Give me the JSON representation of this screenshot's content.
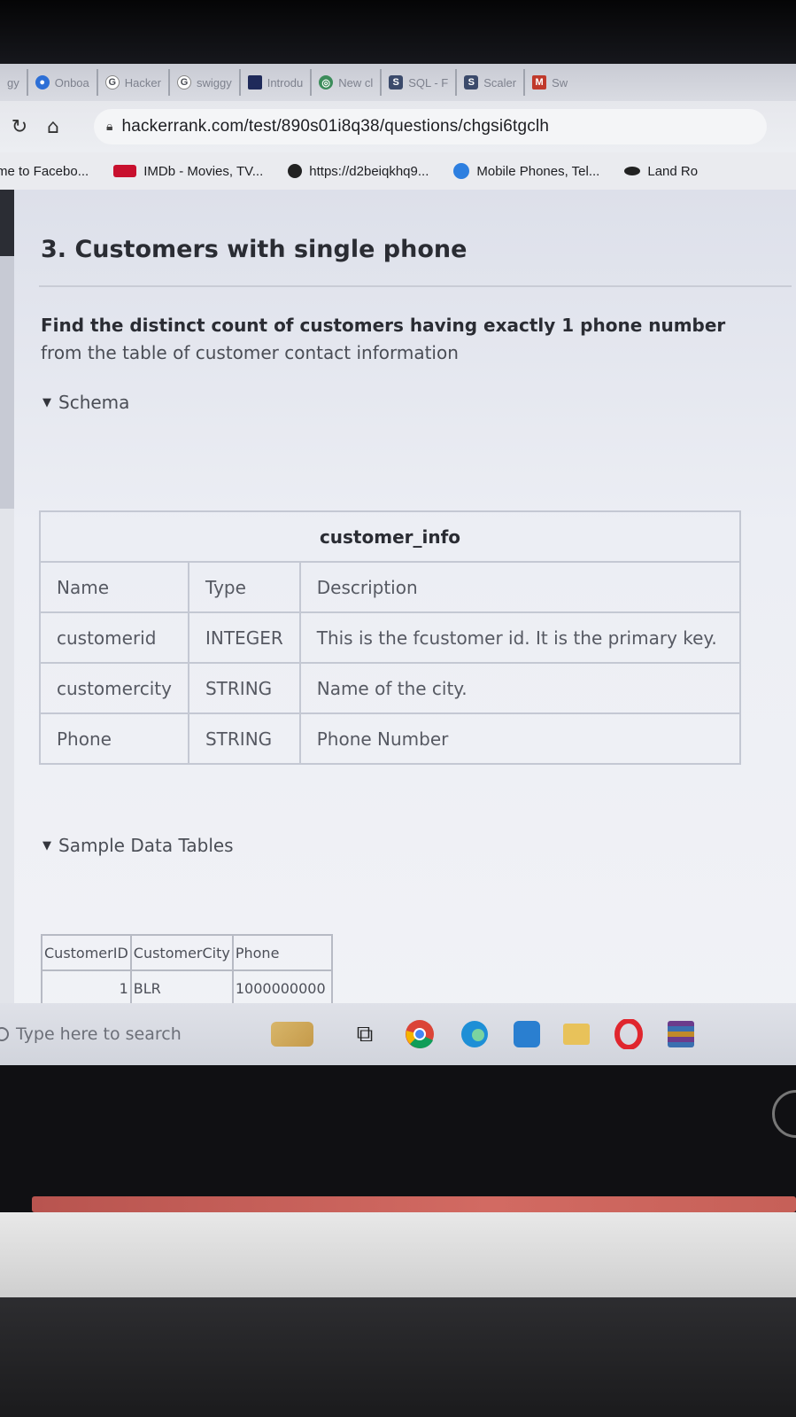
{
  "browser": {
    "tabs": [
      {
        "label": "Onboa",
        "icon": "onboarding-icon",
        "color": "#2d6fd6"
      },
      {
        "label": "Hacker",
        "icon": "google-icon",
        "color": "#4a4d55"
      },
      {
        "label": "swiggy",
        "icon": "google-icon",
        "color": "#4a4d55"
      },
      {
        "label": "Introdu",
        "icon": "page-icon",
        "color": "#1f2a5a"
      },
      {
        "label": "New cl",
        "icon": "new-tab-icon",
        "color": "#3b8c5a"
      },
      {
        "label": "SQL - F",
        "icon": "scaler-icon",
        "color": "#3b4a6b"
      },
      {
        "label": "Scaler",
        "icon": "scaler-icon",
        "color": "#3b4a6b"
      },
      {
        "label": "Sw",
        "icon": "gmail-icon",
        "color": "#c0392b"
      }
    ],
    "url": "hackerrank.com/test/890s01i8q38/questions/chgsi6tgclh",
    "bookmarks": [
      {
        "label": "me to Facebo...",
        "color": "#3b5998"
      },
      {
        "label": "IMDb - Movies, TV...",
        "color": "#c8102e"
      },
      {
        "label": "https://d2beiqkhq9...",
        "color": "#222"
      },
      {
        "label": "Mobile Phones, Tel...",
        "color": "#2d7fe0"
      },
      {
        "label": "Land Ro",
        "color": "#222"
      }
    ]
  },
  "question": {
    "title": "3. Customers with single phone",
    "body_bold": "Find the distinct count of customers having exactly 1 phone number",
    "body_rest": " from the table of customer contact information"
  },
  "schema": {
    "toggle_label": "Schema",
    "table_name": "customer_info",
    "headers": [
      "Name",
      "Type",
      "Description"
    ],
    "rows": [
      [
        "customerid",
        "INTEGER",
        "This is the fcustomer id. It is the primary key."
      ],
      [
        "customercity",
        "STRING",
        "Name of the city."
      ],
      [
        "Phone",
        "STRING",
        "Phone Number"
      ]
    ]
  },
  "sample": {
    "toggle_label": "Sample Data Tables",
    "headers": [
      "CustomerID",
      "CustomerCity",
      "Phone"
    ],
    "rows": [
      [
        "1",
        "BLR",
        "1000000000"
      ]
    ]
  },
  "taskbar": {
    "search_placeholder": "Type here to search",
    "icons": [
      "weather-icon",
      "task-view-icon",
      "chrome-icon",
      "edge-icon",
      "store-icon",
      "file-explorer-icon",
      "opera-icon",
      "winrar-icon"
    ]
  }
}
